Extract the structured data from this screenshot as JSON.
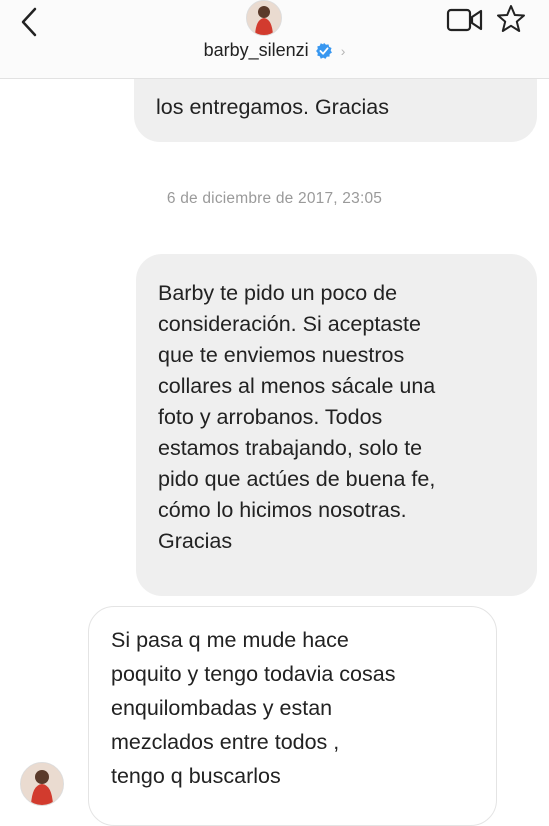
{
  "header": {
    "username": "barby_silenzi",
    "back_icon": "chevron-left-icon",
    "video_icon": "video-camera-icon",
    "star_icon": "star-outline-icon",
    "verified_color": "#3897f0"
  },
  "messages": {
    "previous_partial": "los entregamos. Gracias",
    "timestamp": "6 de diciembre de 2017, 23:05",
    "outgoing": {
      "lines": [
        "Barby te pido un poco de",
        "consideración. Si aceptaste",
        "que te enviemos nuestros",
        "collares al menos sácale una",
        "foto y arrobanos. Todos",
        "estamos trabajando, solo te",
        "pido que actúes de buena fe,",
        "cómo lo hicimos nosotras.",
        "Gracias"
      ]
    },
    "incoming": {
      "lines": [
        "Si pasa q me mude hace",
        "poquito y tengo todavia cosas",
        "enquilombadas y estan",
        "mezclados entre todos ,",
        "tengo q buscarlos"
      ]
    }
  },
  "colors": {
    "bubble_gray": "#efefef",
    "text": "#222222",
    "timestamp": "#9a9a9a"
  }
}
